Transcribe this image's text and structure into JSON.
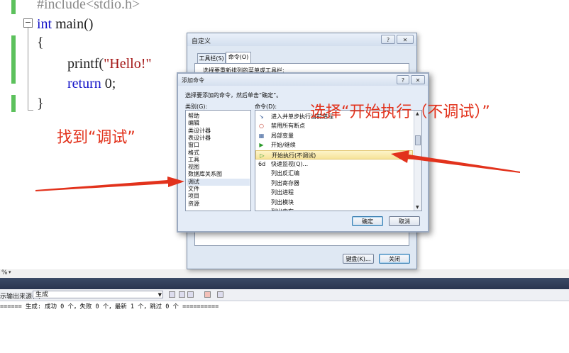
{
  "editor": {
    "line_include": "#include<stdio.h>",
    "line_int_kw": "int",
    "line_main": " main()",
    "brace_open": "{",
    "printf_fn": "printf(",
    "printf_str": "\"Hello!\"",
    "return_kw": "return",
    "return_val": " 0;",
    "brace_close": "}",
    "gutter_color": "#5cc15c"
  },
  "status": {
    "zoom_label": "%"
  },
  "output": {
    "source_label": "示输出来源(S):",
    "source_value": "生成",
    "build_text": "====== 生成: 成功 0 个，失败 0 个，最新 1 个，跳过 0 个 =========="
  },
  "customize_dialog": {
    "title": "自定义",
    "help_button": "?",
    "close_button": "✕",
    "tabs": [
      "工具栏(S)",
      "命令(O)"
    ],
    "instruction": "选择要重新排列的菜单或工具栏:",
    "keyboard_button": "键盘(K)...",
    "close_label": "关闭"
  },
  "add_command_dialog": {
    "title": "添加命令",
    "help_button": "?",
    "close_button": "✕",
    "instruction": "选择要添加的命令，然后单击“确定”。",
    "categories_label": "类别(G):",
    "commands_label": "命令(D):",
    "categories": [
      "帮助",
      "编辑",
      "类设计器",
      "表设计器",
      "窗口",
      "格式",
      "工具",
      "视图",
      "数据库关系图",
      "调试",
      "文件",
      "项目",
      "资源"
    ],
    "selected_category": "调试",
    "commands": [
      {
        "icon": "step-into-icon",
        "glyph": "↘",
        "label": "进入并单步执行当前进程"
      },
      {
        "icon": "disable-breakpoints-icon",
        "glyph": "○",
        "label": "禁用所有断点"
      },
      {
        "icon": "locals-icon",
        "glyph": "▦",
        "label": "局部变量"
      },
      {
        "icon": "start-continue-icon",
        "glyph": "▶",
        "label": "开始/继续"
      },
      {
        "icon": "start-without-debugging-icon",
        "glyph": "▷",
        "label": "开始执行(不调试)"
      },
      {
        "icon": "quickwatch-icon",
        "glyph": "6d",
        "label": "快速监视(Q)..."
      },
      {
        "icon": "",
        "glyph": "",
        "label": "列出反汇编"
      },
      {
        "icon": "",
        "glyph": "",
        "label": "列出寄存器"
      },
      {
        "icon": "",
        "glyph": "",
        "label": "列出进程"
      },
      {
        "icon": "",
        "glyph": "",
        "label": "列出模块"
      },
      {
        "icon": "",
        "glyph": "",
        "label": "列出内存"
      }
    ],
    "selected_command": "开始执行(不调试)",
    "ok_button": "确定",
    "cancel_button": "取消"
  },
  "annotations": {
    "find_debug": "找到“调试”",
    "choose_start": "选择“开始执行（不调试）”",
    "color": "#e2321c"
  }
}
